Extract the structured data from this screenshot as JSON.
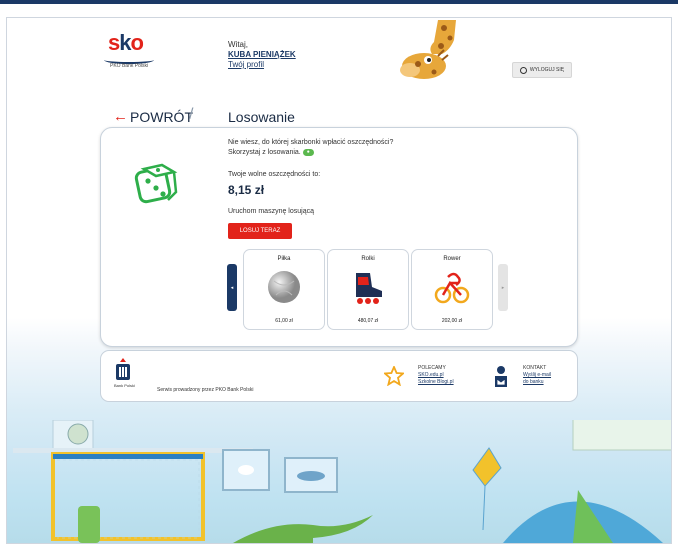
{
  "header": {
    "logo_text": "sko",
    "logo_subtitle": "PKO Bank Polski",
    "greeting": "Witaj,",
    "user_name": "KUBA PIENIĄŻEK",
    "profile_link": "Twój profil",
    "logout_label": "WYLOGUJ SIĘ"
  },
  "breadcrumb": {
    "back_label": "POWRÓT",
    "separator": "/",
    "page_title": "Losowanie"
  },
  "main": {
    "question_line1": "Nie wiesz, do której skarbonki wpłacić oszczędności?",
    "question_line2": "Skorzystaj z losowania.",
    "question_badge": "●",
    "free_savings_label": "Twoje wolne oszczędności to:",
    "free_savings_amount": "8,15 zł",
    "machine_label": "Uruchom maszynę losującą",
    "draw_button": "LOSUJ TERAZ",
    "carousel_prev": "◂",
    "carousel_next": "▸",
    "products": [
      {
        "name": "Piłka",
        "price": "61,00 zł"
      },
      {
        "name": "Rolki",
        "price": "480,07 zł"
      },
      {
        "name": "Rower",
        "price": "202,00 zł"
      }
    ]
  },
  "footer": {
    "bank_label": "Bank Polski",
    "service_text": "Serwis prowadzony przez PKO Bank Polski",
    "recommend_title": "POLECAMY",
    "recommend_link1": "SKO.edu.pl",
    "recommend_link2": "Szkolne Blogi.pl",
    "contact_title": "KONTAKT",
    "contact_link1": "Wyślij e-mail",
    "contact_link2": "do banku"
  },
  "colors": {
    "brand_navy": "#1b3966",
    "accent_red": "#e2231a",
    "dice_green": "#2eae4a"
  }
}
